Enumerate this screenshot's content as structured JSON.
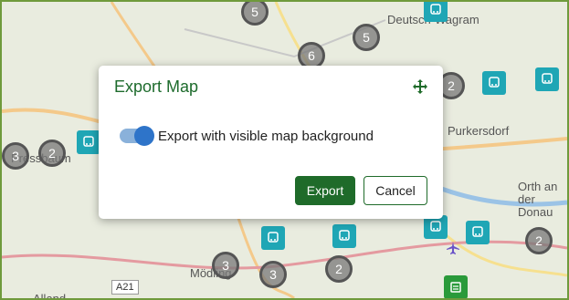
{
  "dialog": {
    "title": "Export Map",
    "toggle_label": "Export with visible map background",
    "toggle_on": true,
    "export_label": "Export",
    "cancel_label": "Cancel"
  },
  "map": {
    "place_labels": [
      "Deutsch-Wagram",
      "Purkersdorf",
      "Orth an der Donau",
      "Mödling",
      "Alland",
      "Pressbaum"
    ],
    "road_label": "A21",
    "clusters": [
      "5",
      "5",
      "6",
      "2",
      "3",
      "2",
      "3",
      "3",
      "2",
      "2"
    ]
  },
  "colors": {
    "accent": "#1f6b2a",
    "toggle": "#2e74c9",
    "stop": "#1fa6b5"
  }
}
